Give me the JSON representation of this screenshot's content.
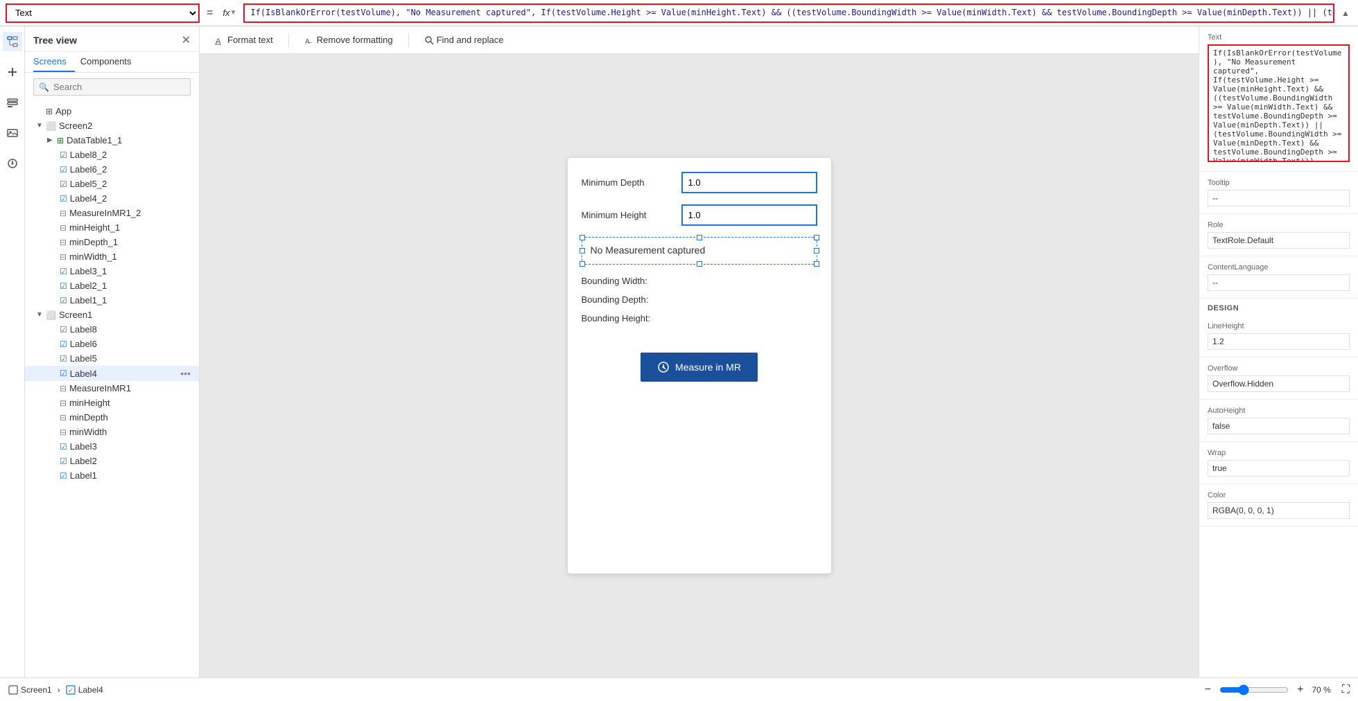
{
  "formula_bar": {
    "select_value": "Text",
    "equals": "=",
    "fx": "fx",
    "expression": "If(IsBlankOrError(testVolume), \"No Measurement captured\", If(testVolume.Height >= Value(minHeight.Text) && ((testVolume.BoundingWidth >= Value(minWidth.Text) && testVolume.BoundingDepth >= Value(minDepth.Text)) || (testVolume.BoundingWidth >= Value(minDepth.Text) && testVolume.BoundingDepth >= Value(minWidth.Text))), \"Fit Test Succeeded\", \"Fit Test Failed\"))"
  },
  "tree_view": {
    "title": "Tree view",
    "tabs": [
      "Screens",
      "Components"
    ],
    "active_tab": "Screens",
    "search_placeholder": "Search",
    "items": [
      {
        "level": 0,
        "type": "app",
        "icon": "app",
        "label": "App",
        "expanded": false
      },
      {
        "level": 0,
        "type": "screen",
        "icon": "screen",
        "label": "Screen2",
        "expanded": true,
        "chevron": "▼"
      },
      {
        "level": 1,
        "type": "table",
        "icon": "table",
        "label": "DataTable1_1",
        "chevron": "▶"
      },
      {
        "level": 1,
        "type": "label",
        "icon": "label",
        "label": "Label8_2"
      },
      {
        "level": 1,
        "type": "label",
        "icon": "label",
        "label": "Label6_2"
      },
      {
        "level": 1,
        "type": "label",
        "icon": "label",
        "label": "Label5_2"
      },
      {
        "level": 1,
        "type": "label",
        "icon": "label",
        "label": "Label4_2"
      },
      {
        "level": 1,
        "type": "input",
        "icon": "input",
        "label": "MeasureInMR1_2"
      },
      {
        "level": 1,
        "type": "measure",
        "icon": "measure",
        "label": "minHeight_1"
      },
      {
        "level": 1,
        "type": "measure",
        "icon": "measure",
        "label": "minDepth_1"
      },
      {
        "level": 1,
        "type": "measure",
        "icon": "measure",
        "label": "minWidth_1"
      },
      {
        "level": 1,
        "type": "label",
        "icon": "label",
        "label": "Label3_1"
      },
      {
        "level": 1,
        "type": "label",
        "icon": "label",
        "label": "Label2_1"
      },
      {
        "level": 1,
        "type": "label",
        "icon": "label",
        "label": "Label1_1"
      },
      {
        "level": 0,
        "type": "screen",
        "icon": "screen",
        "label": "Screen1",
        "expanded": true,
        "chevron": "▼"
      },
      {
        "level": 1,
        "type": "label",
        "icon": "label",
        "label": "Label8"
      },
      {
        "level": 1,
        "type": "label",
        "icon": "label",
        "label": "Label6"
      },
      {
        "level": 1,
        "type": "label",
        "icon": "label",
        "label": "Label5"
      },
      {
        "level": 1,
        "type": "label",
        "icon": "label",
        "label": "Label4",
        "selected": true,
        "has_more": true
      },
      {
        "level": 1,
        "type": "input",
        "icon": "input",
        "label": "MeasureInMR1"
      },
      {
        "level": 1,
        "type": "measure",
        "icon": "measure",
        "label": "minHeight"
      },
      {
        "level": 1,
        "type": "measure",
        "icon": "measure",
        "label": "minDepth"
      },
      {
        "level": 1,
        "type": "measure",
        "icon": "measure",
        "label": "minWidth"
      },
      {
        "level": 1,
        "type": "label",
        "icon": "label",
        "label": "Label3"
      },
      {
        "level": 1,
        "type": "label",
        "icon": "label",
        "label": "Label2"
      },
      {
        "level": 1,
        "type": "label",
        "icon": "label",
        "label": "Label1"
      }
    ]
  },
  "canvas_toolbar": {
    "format_text": "Format text",
    "remove_formatting": "Remove formatting",
    "find_replace": "Find and replace"
  },
  "app_screen": {
    "min_depth_label": "Minimum Depth",
    "min_depth_value": "1.0",
    "min_height_label": "Minimum Height",
    "min_height_value": "1.0",
    "label4_text": "No Measurement captured",
    "bounding_width": "Bounding Width:",
    "bounding_depth": "Bounding Depth:",
    "bounding_height": "Bounding Height:",
    "measure_btn": "Measure in MR"
  },
  "properties_panel": {
    "text_label": "Text",
    "text_value": "If(IsBlankOrError(testVolume), \"No Measurement captured\", If(testVolume.Height >= Value(minHeight.Text) && ((testVolume.BoundingWidth >= Value(minWidth.Text) && testVolume.BoundingDepth >= Value(minDepth.Text)) || (testVolume.BoundingWidth >= Value(minDepth.Text) && testVolume.BoundingDepth >= Value(minWidth.Text))),",
    "tooltip_label": "Tooltip",
    "tooltip_value": "--",
    "role_label": "Role",
    "role_value": "TextRole.Default",
    "content_language_label": "ContentLanguage",
    "content_language_value": "--",
    "design_title": "DESIGN",
    "line_height_label": "LineHeight",
    "line_height_value": "1.2",
    "overflow_label": "Overflow",
    "overflow_value": "Overflow.Hidden",
    "auto_height_label": "AutoHeight",
    "auto_height_value": "false",
    "wrap_label": "Wrap",
    "wrap_value": "true",
    "color_label": "Color",
    "color_value": "RGBA(0, 0, 0, 1)"
  },
  "status_bar": {
    "screen": "Screen1",
    "label": "Label4",
    "zoom_minus": "−",
    "zoom_plus": "+",
    "zoom_value": "70 %",
    "fullscreen_icon": "⛶"
  }
}
